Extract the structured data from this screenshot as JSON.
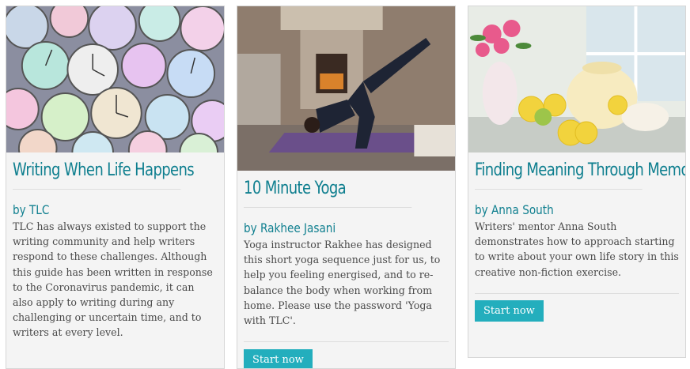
{
  "cards": [
    {
      "image_alt": "Pile of colourful stopwatches",
      "title": "Writing When Life Happens",
      "author": "by TLC",
      "description": "TLC has always existed to support the writing community and help writers respond to these challenges. Although this guide has been written in response to the Coronavirus pandemic, it can also apply to writing during any challenging or uncertain time, and to writers at every level."
    },
    {
      "image_alt": "Woman doing a yoga pose on a purple mat",
      "title": "10 Minute Yoga",
      "author": "by Rakhee Jasani",
      "description": "Yoga instructor Rakhee has designed this short yoga sequence just for us, to help you feeling energised, and to re-balance the body when working from home. Please use the password 'Yoga with TLC'.",
      "button": "Start now"
    },
    {
      "image_alt": "Teapot, teacups, lemons and flowers on a table",
      "title": "Finding Meaning Through Memoir",
      "author": "by Anna South",
      "description": "Writers' mentor Anna South demonstrates how to approach starting to write about your own life story in this creative non-fiction exercise.",
      "button": "Start now"
    }
  ],
  "colors": {
    "accent": "#0f7f8f",
    "button": "#23aebd",
    "card_bg": "#f4f4f4"
  }
}
